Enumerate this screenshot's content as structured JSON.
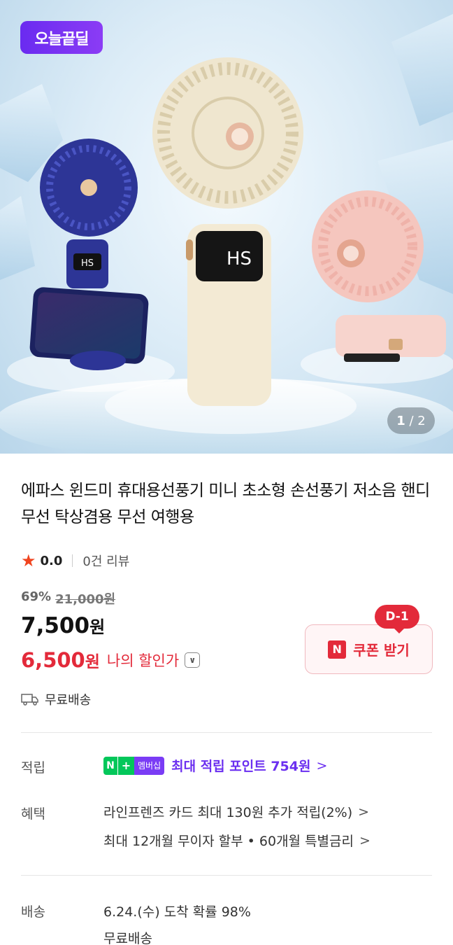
{
  "hero": {
    "badge": "오늘끝딜",
    "pager_current": "1",
    "pager_total": "/ 2",
    "fan_display_text": "HS"
  },
  "product": {
    "title": "에파스 윈드미 휴대용선풍기 미니 초소형 손선풍기 저소음 핸디 무선 탁상겸용 무선 여행용",
    "rating": "0.0",
    "reviews": "0건 리뷰",
    "discount_rate": "69%",
    "original_price": "21,000원",
    "price": "7,500",
    "price_unit": "원",
    "my_price": "6,500",
    "my_price_unit": "원",
    "my_price_label": "나의 할인가",
    "shipping": "무료배송"
  },
  "coupon": {
    "dday": "D-1",
    "logo": "N",
    "label": "쿠폰 받기"
  },
  "info": {
    "points_label": "적립",
    "points_badge_n": "N",
    "points_badge_plus": "+",
    "points_badge_membership": "멤버십",
    "points_text": "최대 적립 포인트 754원",
    "benefit_label": "혜택",
    "benefit_1": "라인프렌즈 카드 최대 130원 추가 적립(2%)",
    "benefit_2": "최대 12개월 무이자 할부 • 60개월 특별금리",
    "delivery_label": "배송",
    "delivery_1": "6.24.(수) 도착 확률 98%",
    "delivery_2": "무료배송"
  },
  "colors": {
    "accent_red": "#e32a3a",
    "naver_green": "#03c75a",
    "purple": "#6b2ff0"
  }
}
